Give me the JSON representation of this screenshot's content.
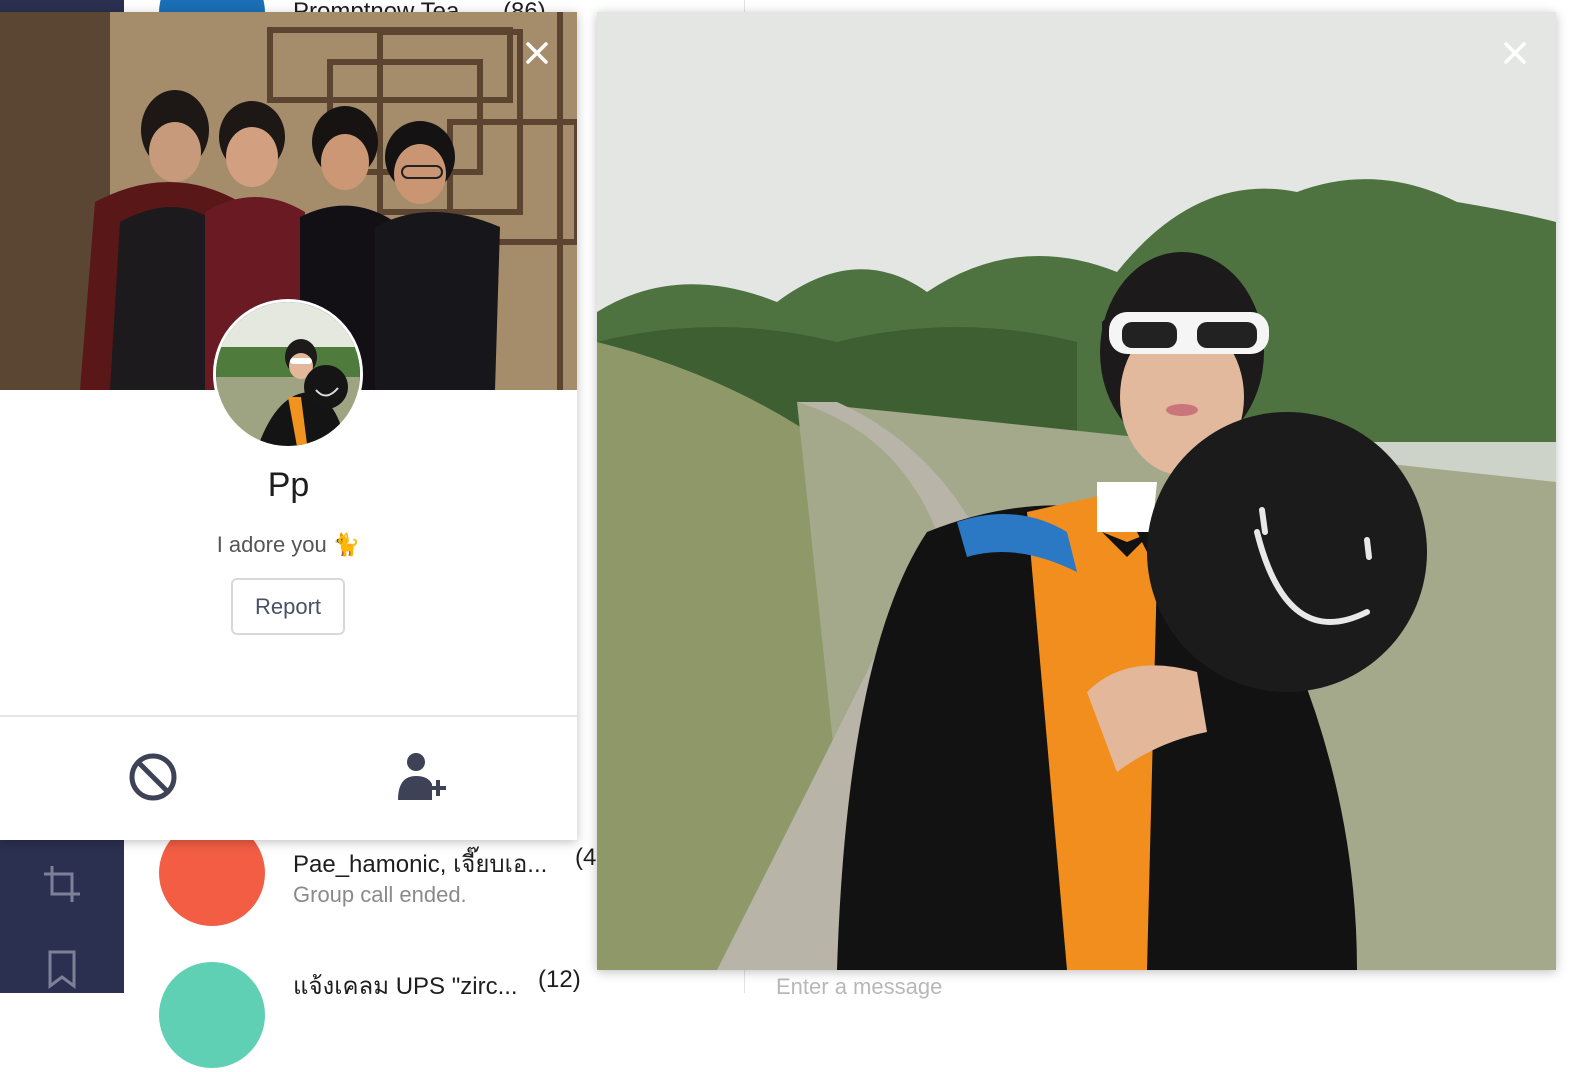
{
  "background_app": {
    "chat_list": [
      {
        "name": "Promptnow Tea...",
        "count": "(86)",
        "preview": ""
      },
      {
        "name": "Pae_hamonic, เจี๊ยบเอ...",
        "count": "(4",
        "preview": "Group call ended."
      },
      {
        "name": "แจ้งเคลม UPS \"zirc...",
        "count": "(12)",
        "preview": ""
      }
    ],
    "message_input_placeholder": "Enter a message",
    "sidebar_icons": [
      "crop-icon",
      "bookmark-icon"
    ]
  },
  "profile": {
    "name": "Pp",
    "status": "I adore you 🐈",
    "report_label": "Report",
    "actions": [
      "block-icon",
      "add-friend-icon"
    ],
    "close_icon": "close-icon"
  },
  "photo_viewer": {
    "close_icon": "close-icon"
  },
  "colors": {
    "sidebar": "#2b3050",
    "chat_avatar_red": "#f25d44",
    "icon_dark": "#3d4257",
    "accent_green": "#06c755"
  }
}
